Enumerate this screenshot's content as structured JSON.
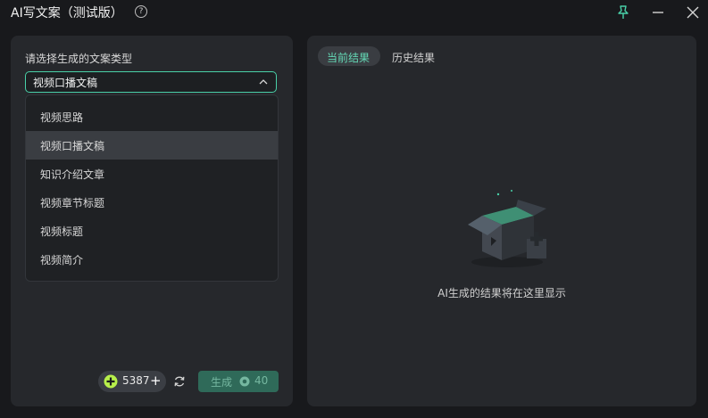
{
  "window": {
    "title": "AI写文案（测试版）",
    "help_glyph": "?"
  },
  "left_panel": {
    "prompt": "请选择生成的文案类型",
    "selected_value": "视频口播文稿",
    "options": [
      {
        "label": "视频思路"
      },
      {
        "label": "视频口播文稿",
        "selected": true
      },
      {
        "label": "知识介绍文章"
      },
      {
        "label": "视频章节标题"
      },
      {
        "label": "视频标题"
      },
      {
        "label": "视频简介"
      }
    ],
    "credits": {
      "count": "5387",
      "plus": "+"
    },
    "generate": {
      "label": "生成",
      "cost": "40"
    }
  },
  "right_panel": {
    "tabs": [
      "当前结果",
      "历史结果"
    ],
    "active_tab": "当前结果",
    "empty_text": "AI生成的结果将在这里显示"
  },
  "colors": {
    "accent": "#49d0a8",
    "generate_bg": "#2f6a59",
    "panel_bg": "#26282c",
    "window_bg": "#18191c"
  },
  "icons": [
    "help-icon",
    "pin-icon",
    "minimize-icon",
    "close-icon",
    "chevron-up-icon",
    "credit-icon",
    "refresh-icon",
    "coin-icon",
    "empty-box-icon"
  ]
}
